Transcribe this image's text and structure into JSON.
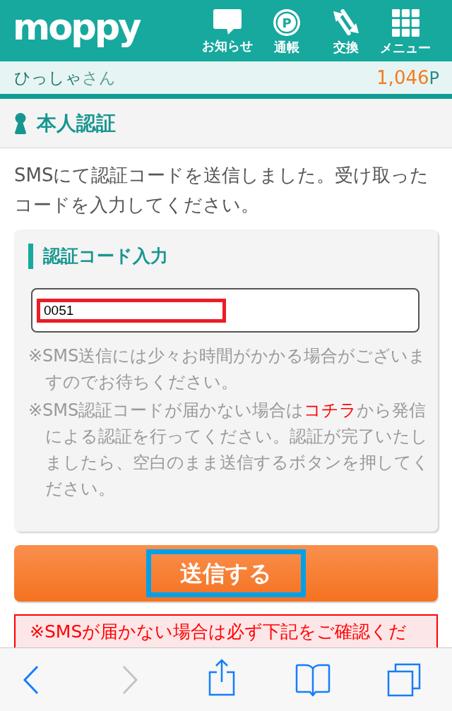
{
  "header": {
    "logo": "moppy",
    "nav": [
      {
        "label": "お知らせ"
      },
      {
        "label": "通帳",
        "icon_text": "P"
      },
      {
        "label": "交換"
      },
      {
        "label": "メニュー"
      }
    ]
  },
  "user_bar": {
    "name": "ひっしゃ",
    "honorific": "さん",
    "points": "1,046",
    "points_unit": "P"
  },
  "page_title": "本人認証",
  "intro": "SMSにて認証コードを送信しました。受け取ったコードを入力してください。",
  "code_form": {
    "heading": "認証コード入力",
    "input": {
      "value": "0051",
      "highlighted": true
    },
    "notes": [
      {
        "text": "※SMS送信には少々お時間がかかる場合がございますのでお待ちください。"
      },
      {
        "text": "※SMS認証コードが届かない場合は",
        "link": "コチラ",
        "text_after": "から発信による認証を行ってください。認証が完了いたしましたら、空白のまま送信するボタンを押してください。"
      }
    ]
  },
  "submit_button": {
    "label": "送信する",
    "highlighted": true
  },
  "notice": {
    "text": "※SMSが届かない場合は必ず下記をご確認くだ"
  },
  "browser_toolbar": {
    "back": {
      "disabled": false
    },
    "forward": {
      "disabled": true
    }
  }
}
